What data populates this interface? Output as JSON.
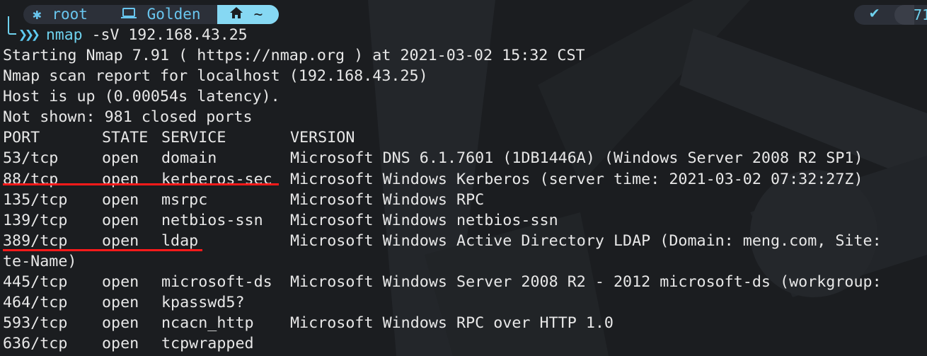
{
  "prompt": {
    "user": "root",
    "host": "Golden",
    "dir": "~",
    "status_number": "71",
    "command": "nmap",
    "args": " -sV 192.168.43.25"
  },
  "output": {
    "intro": [
      "Starting Nmap 7.91 ( https://nmap.org ) at 2021-03-02 15:32 CST",
      "Nmap scan report for localhost (192.168.43.25)",
      "Host is up (0.00054s latency).",
      "Not shown: 981 closed ports"
    ],
    "header": {
      "port": "PORT",
      "state": "STATE",
      "service": "SERVICE",
      "version": "VERSION"
    },
    "rows": [
      {
        "port": "53/tcp",
        "state": "open",
        "service": "domain",
        "version": "Microsoft DNS 6.1.7601 (1DB1446A) (Windows Server 2008 R2 SP1)"
      },
      {
        "port": "88/tcp",
        "state": "open",
        "service": "kerberos-sec",
        "version": "Microsoft Windows Kerberos (server time: 2021-03-02 07:32:27Z)"
      },
      {
        "port": "135/tcp",
        "state": "open",
        "service": "msrpc",
        "version": "Microsoft Windows RPC"
      },
      {
        "port": "139/tcp",
        "state": "open",
        "service": "netbios-ssn",
        "version": "Microsoft Windows netbios-ssn"
      },
      {
        "port": "389/tcp",
        "state": "open",
        "service": "ldap",
        "version": "Microsoft Windows Active Directory LDAP (Domain: meng.com, Site:"
      },
      {
        "port": "te-Name)",
        "state": "",
        "service": "",
        "version": ""
      },
      {
        "port": "445/tcp",
        "state": "open",
        "service": "microsoft-ds",
        "version": "Microsoft Windows Server 2008 R2 - 2012 microsoft-ds (workgroup:"
      },
      {
        "port": "464/tcp",
        "state": "open",
        "service": "kpasswd5?",
        "version": ""
      },
      {
        "port": "593/tcp",
        "state": "open",
        "service": "ncacn_http",
        "version": "Microsoft Windows RPC over HTTP 1.0"
      },
      {
        "port": "636/tcp",
        "state": "open",
        "service": "tcpwrapped",
        "version": ""
      }
    ]
  },
  "colors": {
    "underline": "#ff1a1a",
    "accent": "#6fd2ee"
  }
}
